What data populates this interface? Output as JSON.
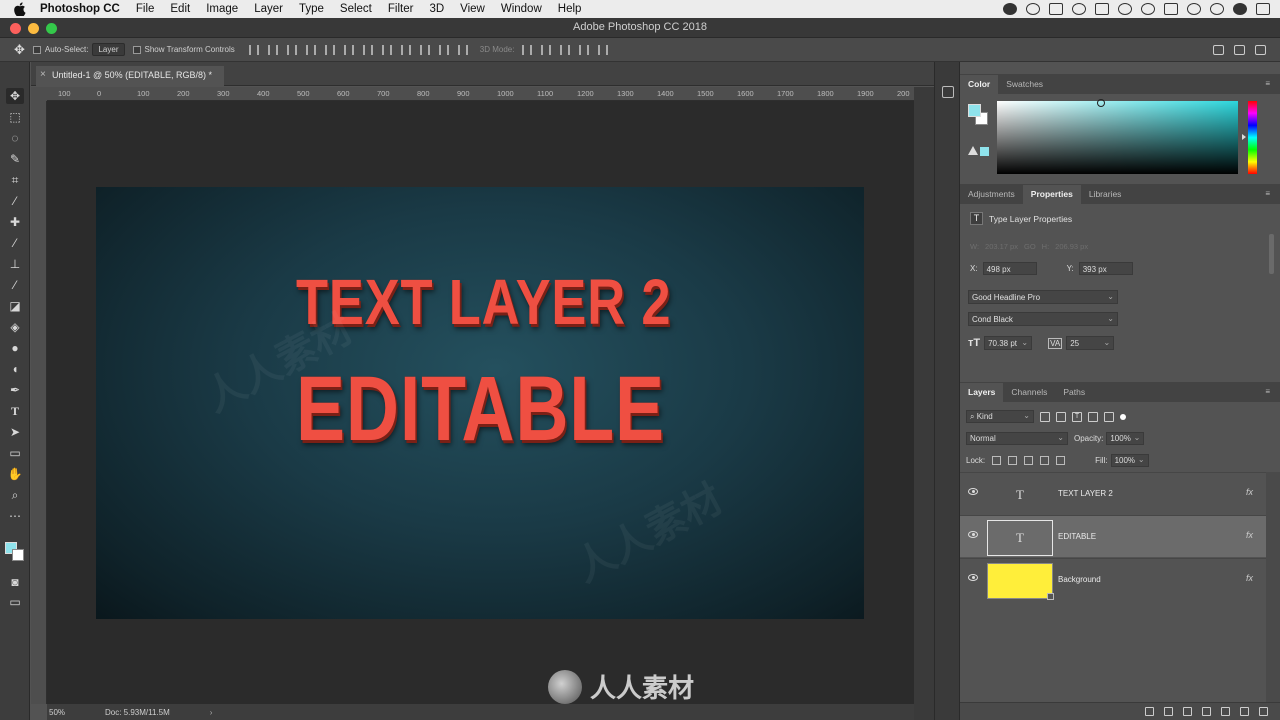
{
  "menubar": {
    "app_name": "Photoshop CC",
    "items": [
      "File",
      "Edit",
      "Image",
      "Layer",
      "Type",
      "Select",
      "Filter",
      "3D",
      "View",
      "Window",
      "Help"
    ]
  },
  "window": {
    "title": "Adobe Photoshop CC 2018",
    "traffic_lights": [
      "#fc605c",
      "#fcbb40",
      "#34c84a"
    ]
  },
  "options_bar": {
    "auto_select_label": "Auto-Select:",
    "auto_select_value": "Layer",
    "show_transform_label": "Show Transform Controls",
    "mode_3d_label": "3D Mode:"
  },
  "document": {
    "tab_title": "Untitled-1 @ 50% (EDITABLE, RGB/8) *",
    "ruler_ticks": [
      "100",
      "0",
      "100",
      "200",
      "300",
      "400",
      "500",
      "600",
      "700",
      "800",
      "900",
      "1000",
      "1100",
      "1200",
      "1300",
      "1400",
      "1500",
      "1600",
      "1700",
      "1800",
      "1900",
      "200"
    ],
    "canvas_line1": "TEXT LAYER 2",
    "canvas_line2": "EDITABLE",
    "canvas_text_color": "#ef4f42"
  },
  "status_bar": {
    "zoom": "50%",
    "doc_size": "Doc: 5.93M/11.5M"
  },
  "color_panel": {
    "tabs": [
      "Color",
      "Swatches"
    ],
    "foreground_color": "#8fe3ec",
    "background_color": "#ffffff"
  },
  "properties_panel": {
    "tabs": [
      "Adjustments",
      "Properties",
      "Libraries"
    ],
    "header": "Type Layer Properties",
    "w_label": "W:",
    "w_value": "203.17 px",
    "go_label": "GO",
    "h_label": "H:",
    "h_value": "206.93 px",
    "x_label": "X:",
    "x_value": "498 px",
    "y_label": "Y:",
    "y_value": "393 px",
    "font_family": "Good Headline Pro",
    "font_style": "Cond Black",
    "font_size": "70.38 pt",
    "tracking": "25"
  },
  "layers_panel": {
    "tabs": [
      "Layers",
      "Channels",
      "Paths"
    ],
    "filter_kind": "Kind",
    "blend_mode": "Normal",
    "opacity_label": "Opacity:",
    "opacity_value": "100%",
    "lock_label": "Lock:",
    "fill_label": "Fill:",
    "fill_value": "100%",
    "layers": [
      {
        "name": "TEXT LAYER 2",
        "type_glyph": "T",
        "fx": "fx"
      },
      {
        "name": "EDITABLE",
        "type_glyph": "T",
        "fx": "fx"
      },
      {
        "name": "Background",
        "fx": "fx",
        "thumb_color": "#ffee3a"
      }
    ]
  },
  "watermark": {
    "text": "人人素材"
  }
}
